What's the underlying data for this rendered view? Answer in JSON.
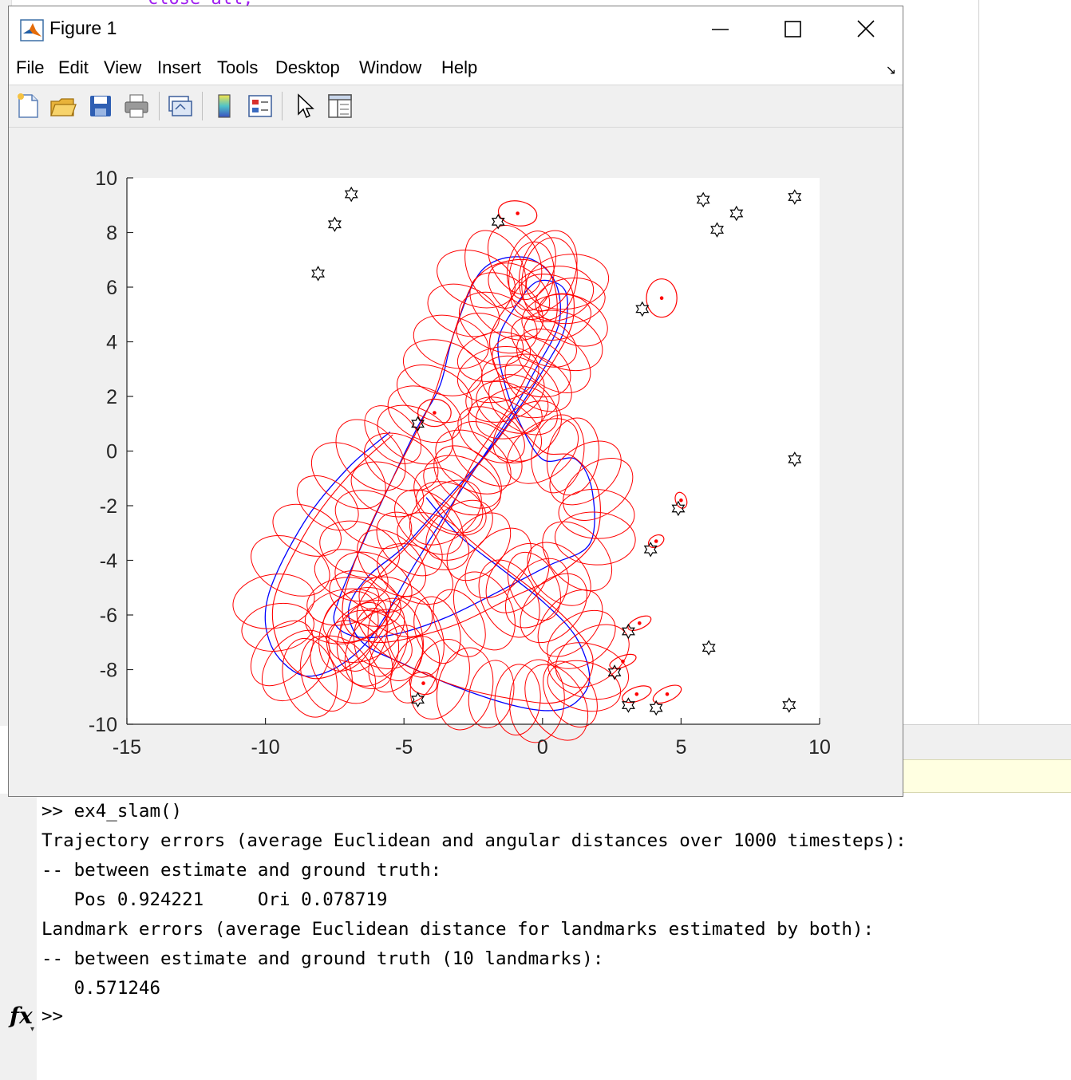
{
  "editor": {
    "code_fragment": "close all;"
  },
  "window": {
    "title": "Figure 1",
    "menu": [
      "File",
      "Edit",
      "View",
      "Insert",
      "Tools",
      "Desktop",
      "Window",
      "Help"
    ],
    "toolbar_icons": [
      "new-figure-icon",
      "open-file-icon",
      "save-icon",
      "print-icon",
      "link-plot-icon",
      "colorbar-icon",
      "legend-icon",
      "pointer-icon",
      "property-editor-icon"
    ]
  },
  "chart_data": {
    "type": "scatter",
    "title": "",
    "xlabel": "",
    "ylabel": "",
    "xlim": [
      -15,
      10
    ],
    "ylim": [
      -10,
      10
    ],
    "xticks": [
      -15,
      -10,
      -5,
      0,
      5,
      10
    ],
    "yticks": [
      -10,
      -8,
      -6,
      -4,
      -2,
      0,
      2,
      4,
      6,
      8,
      10
    ],
    "grid": false,
    "legend": "none",
    "colors": {
      "true_path": "#0000ff",
      "estimate": "#ff0000",
      "landmarks": "#000000"
    },
    "landmarks_true": [
      [
        -6.9,
        9.4
      ],
      [
        -7.5,
        8.3
      ],
      [
        -8.1,
        6.5
      ],
      [
        -1.6,
        8.4
      ],
      [
        5.8,
        9.2
      ],
      [
        6.3,
        8.1
      ],
      [
        7.0,
        8.7
      ],
      [
        9.1,
        9.3
      ],
      [
        3.6,
        5.2
      ],
      [
        9.1,
        -0.3
      ],
      [
        4.9,
        -2.1
      ],
      [
        3.9,
        -3.6
      ],
      [
        3.1,
        -6.6
      ],
      [
        2.6,
        -8.1
      ],
      [
        3.1,
        -9.3
      ],
      [
        4.1,
        -9.4
      ],
      [
        6.0,
        -7.2
      ],
      [
        8.9,
        -9.3
      ],
      [
        -4.5,
        -9.1
      ],
      [
        -4.5,
        1.0
      ]
    ],
    "landmarks_est": [
      {
        "x": -0.9,
        "y": 8.7,
        "rx": 0.7,
        "ry": 0.45,
        "angle": -10
      },
      {
        "x": 4.3,
        "y": 5.6,
        "rx": 0.55,
        "ry": 0.7,
        "angle": 0
      },
      {
        "x": 5.0,
        "y": -1.8,
        "rx": 0.2,
        "ry": 0.3,
        "angle": 20
      },
      {
        "x": 4.1,
        "y": -3.3,
        "rx": 0.3,
        "ry": 0.2,
        "angle": 30
      },
      {
        "x": 3.5,
        "y": -6.3,
        "rx": 0.45,
        "ry": 0.2,
        "angle": 25
      },
      {
        "x": 2.9,
        "y": -7.7,
        "rx": 0.5,
        "ry": 0.2,
        "angle": 20
      },
      {
        "x": 3.4,
        "y": -8.9,
        "rx": 0.55,
        "ry": 0.25,
        "angle": 20
      },
      {
        "x": 4.5,
        "y": -8.9,
        "rx": 0.55,
        "ry": 0.25,
        "angle": 25
      },
      {
        "x": -4.3,
        "y": -8.5,
        "rx": 0.5,
        "ry": 0.4,
        "angle": -15
      },
      {
        "x": -3.9,
        "y": 1.4,
        "rx": 0.6,
        "ry": 0.5,
        "angle": 0
      }
    ],
    "true_path": [
      [
        -5.5,
        0.7
      ],
      [
        -7.0,
        -0.6
      ],
      [
        -8.6,
        -2.6
      ],
      [
        -9.9,
        -5.3
      ],
      [
        -9.8,
        -7.1
      ],
      [
        -8.7,
        -8.2
      ],
      [
        -7.4,
        -7.9
      ],
      [
        -6.1,
        -6.7
      ],
      [
        -4.7,
        -4.3
      ],
      [
        -3.3,
        -2.0
      ],
      [
        -2.4,
        -0.6
      ],
      [
        -1.1,
        1.4
      ],
      [
        -0.3,
        2.9
      ],
      [
        0.6,
        4.7
      ],
      [
        0.4,
        6.3
      ],
      [
        -0.7,
        7.1
      ],
      [
        -2.2,
        6.6
      ],
      [
        -3.2,
        4.3
      ],
      [
        -3.7,
        2.4
      ],
      [
        -4.5,
        0.9
      ],
      [
        -5.5,
        -1.2
      ],
      [
        -6.5,
        -3.4
      ],
      [
        -7.3,
        -5.3
      ],
      [
        -7.5,
        -6.3
      ],
      [
        -6.7,
        -6.8
      ],
      [
        -5.3,
        -6.7
      ],
      [
        -3.5,
        -6.1
      ],
      [
        -1.5,
        -5.1
      ],
      [
        0.2,
        -4.2
      ],
      [
        1.7,
        -3.4
      ],
      [
        1.8,
        -1.5
      ],
      [
        1.2,
        -0.3
      ],
      [
        0.0,
        -0.3
      ],
      [
        -0.9,
        1.2
      ],
      [
        -1.4,
        2.6
      ],
      [
        -1.6,
        4.0
      ],
      [
        -1.1,
        5.1
      ],
      [
        -0.2,
        6.2
      ],
      [
        0.8,
        5.9
      ],
      [
        0.8,
        4.5
      ],
      [
        0.1,
        3.1
      ],
      [
        -0.9,
        1.5
      ],
      [
        -2.2,
        -0.3
      ],
      [
        -3.6,
        -1.9
      ],
      [
        -5.0,
        -3.5
      ],
      [
        -6.3,
        -4.6
      ],
      [
        -7.0,
        -5.8
      ],
      [
        -6.5,
        -7.0
      ],
      [
        -5.0,
        -7.8
      ],
      [
        -3.2,
        -8.6
      ],
      [
        -1.1,
        -9.3
      ],
      [
        0.3,
        -9.5
      ],
      [
        1.2,
        -9.2
      ],
      [
        1.7,
        -8.3
      ],
      [
        1.2,
        -6.8
      ],
      [
        0.0,
        -5.5
      ],
      [
        -1.5,
        -4.3
      ],
      [
        -3.0,
        -3.1
      ],
      [
        -4.2,
        -1.7
      ]
    ],
    "estimate_path": [
      [
        -5.4,
        0.6
      ],
      [
        -7.0,
        -0.9
      ],
      [
        -8.5,
        -2.9
      ],
      [
        -9.7,
        -5.5
      ],
      [
        -9.4,
        -7.4
      ],
      [
        -8.4,
        -8.3
      ],
      [
        -7.2,
        -8.0
      ],
      [
        -6.0,
        -6.9
      ],
      [
        -4.6,
        -4.5
      ],
      [
        -3.3,
        -2.1
      ],
      [
        -2.5,
        -0.4
      ],
      [
        -1.2,
        1.6
      ],
      [
        -0.4,
        3.1
      ],
      [
        0.5,
        4.9
      ],
      [
        0.2,
        6.6
      ],
      [
        -1.0,
        7.0
      ],
      [
        -2.4,
        6.3
      ],
      [
        -3.3,
        4.0
      ],
      [
        -3.9,
        2.1
      ],
      [
        -4.6,
        0.6
      ],
      [
        -5.6,
        -1.4
      ],
      [
        -6.6,
        -3.6
      ],
      [
        -7.2,
        -5.5
      ],
      [
        -7.0,
        -6.6
      ],
      [
        -6.0,
        -7.0
      ],
      [
        -4.6,
        -6.8
      ],
      [
        -3.0,
        -6.3
      ],
      [
        -1.2,
        -5.4
      ],
      [
        0.6,
        -4.5
      ],
      [
        1.9,
        -3.2
      ],
      [
        2.0,
        -1.4
      ],
      [
        1.1,
        -0.2
      ],
      [
        0.0,
        0.0
      ],
      [
        -1.1,
        1.4
      ],
      [
        -1.6,
        2.8
      ],
      [
        -1.9,
        4.1
      ],
      [
        -1.3,
        5.3
      ],
      [
        -0.4,
        6.4
      ],
      [
        0.9,
        6.2
      ],
      [
        1.1,
        4.8
      ],
      [
        0.4,
        3.3
      ],
      [
        -0.7,
        1.7
      ],
      [
        -2.0,
        -0.1
      ],
      [
        -3.4,
        -1.8
      ],
      [
        -4.8,
        -3.4
      ],
      [
        -6.1,
        -4.8
      ],
      [
        -6.7,
        -6.0
      ],
      [
        -6.0,
        -7.2
      ],
      [
        -4.6,
        -8.0
      ],
      [
        -2.8,
        -8.7
      ],
      [
        -0.9,
        -9.1
      ],
      [
        0.5,
        -9.2
      ],
      [
        1.5,
        -8.6
      ],
      [
        1.8,
        -7.5
      ],
      [
        1.0,
        -6.3
      ],
      [
        -0.2,
        -5.2
      ],
      [
        -1.6,
        -4.1
      ],
      [
        -3.0,
        -2.9
      ],
      [
        -4.0,
        -1.6
      ]
    ]
  },
  "command_window": {
    "lines": [
      ">> ex4_slam()",
      "Trajectory errors (average Euclidean and angular distances over 1000 timesteps):",
      "-- between estimate and ground truth:",
      "   Pos 0.924221     Ori 0.078719",
      "Landmark errors (average Euclidean distance for landmarks estimated by both):",
      "-- between estimate and ground truth (10 landmarks):",
      "   0.571246"
    ],
    "prompt": ">>",
    "fx_label": "fx"
  }
}
